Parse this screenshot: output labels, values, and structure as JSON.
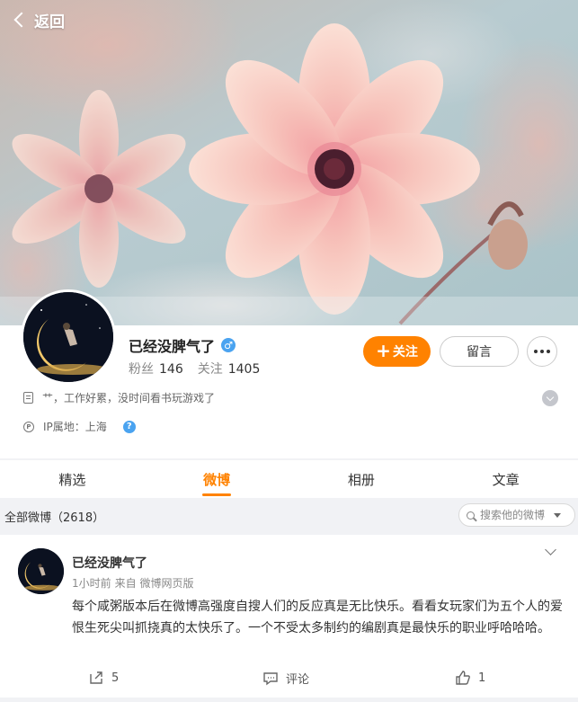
{
  "header": {
    "back_label": "返回"
  },
  "profile": {
    "name": "已经没脾气了",
    "gender_symbol": "♂",
    "fans_label": "粉丝",
    "fans_count": "146",
    "following_label": "关注",
    "following_count": "1405",
    "follow_button": "关注",
    "message_button": "留言",
    "bio": "艹，工作好累，没时间看书玩游戏了",
    "ip_location": "IP属地：上海"
  },
  "tabs": [
    {
      "label": "精选",
      "active": false
    },
    {
      "label": "微博",
      "active": true
    },
    {
      "label": "相册",
      "active": false
    },
    {
      "label": "文章",
      "active": false
    }
  ],
  "filter": {
    "all_posts_label": "全部微博（2618）",
    "search_placeholder": "搜索他的微博"
  },
  "post": {
    "author": "已经没脾气了",
    "time": "1小时前",
    "source": "来自 微博网页版",
    "text": "每个咸粥版本后在微博高强度自搜人们的反应真是无比快乐。看看女玩家们为五个人的爱恨生死尖叫抓挠真的太快乐了。一个不受太多制约的编剧真是最快乐的职业呼哈哈哈。",
    "reposts": "5",
    "comments_label": "评论",
    "likes": "1"
  },
  "colors": {
    "accent": "#ff8200",
    "verified_blue": "#4aa3f0",
    "page_background": "#f1f2f5"
  }
}
